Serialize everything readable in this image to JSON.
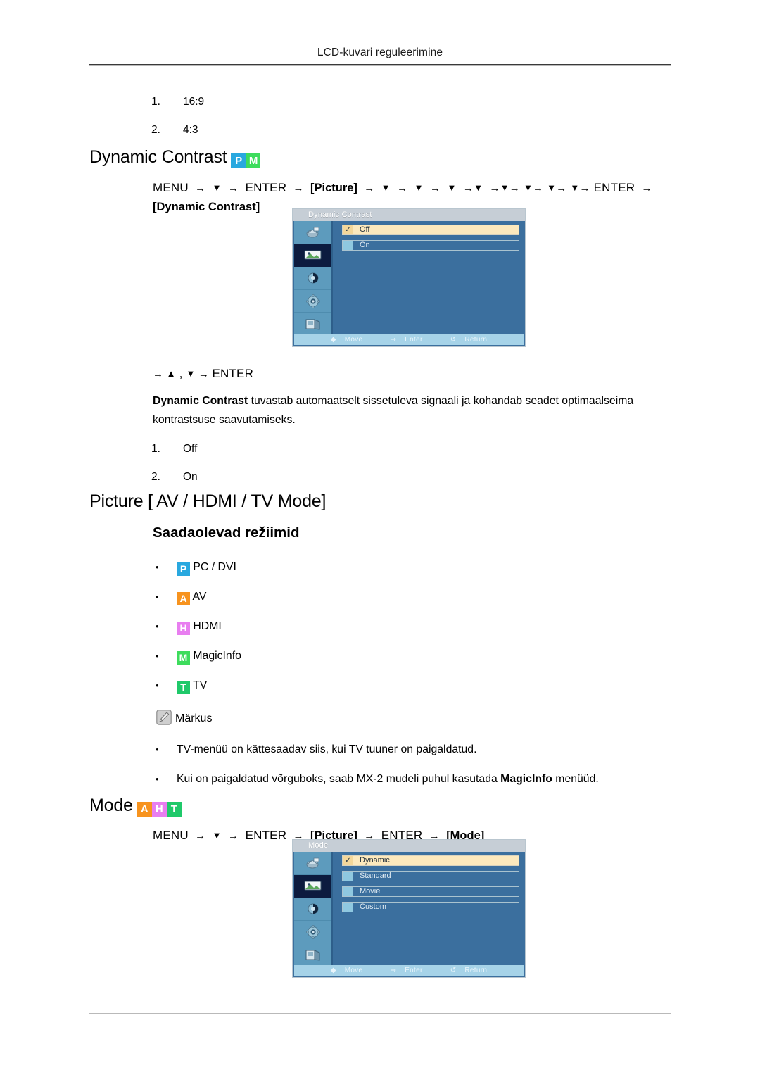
{
  "header": {
    "running_title": "LCD-kuvari reguleerimine"
  },
  "aspect_list": {
    "items": [
      {
        "n": "1.",
        "label": "16:9"
      },
      {
        "n": "2.",
        "label": "4:3"
      }
    ]
  },
  "dynamic_contrast": {
    "heading": "Dynamic Contrast",
    "badges": [
      {
        "letter": "P",
        "color": "#29a8df",
        "name": "badge-pc"
      },
      {
        "letter": "M",
        "color": "#3ddc5c",
        "name": "badge-magicinfo"
      }
    ],
    "path": {
      "menu": "MENU",
      "enter1": "ENTER",
      "picture_tag": "[Picture]",
      "enter2": "ENTER",
      "dc_tag": "[Dynamic Contrast]"
    },
    "nav_line": "→ ▲ , ▼ → ENTER",
    "description_bold": "Dynamic Contrast",
    "description_rest": " tuvastab automaatselt sissetuleva signaali ja kohandab seadet optimaalseima kontrastsuse saavutamiseks.",
    "options": [
      {
        "n": "1.",
        "label": "Off"
      },
      {
        "n": "2.",
        "label": "On"
      }
    ],
    "osd": {
      "title": "Dynamic Contrast",
      "items": [
        {
          "label": "Off",
          "selected": true
        },
        {
          "label": "On",
          "selected": false
        }
      ],
      "footer": [
        {
          "icon": "updown-icon",
          "glyph": "♦",
          "label": "Move"
        },
        {
          "icon": "enter-icon",
          "glyph": "↦",
          "label": "Enter"
        },
        {
          "icon": "return-icon",
          "glyph": "↺",
          "label": "Return"
        }
      ],
      "sidebar_icons": [
        {
          "name": "osd-icon-input",
          "active": false
        },
        {
          "name": "osd-icon-picture",
          "active": true
        },
        {
          "name": "osd-icon-sound",
          "active": false
        },
        {
          "name": "osd-icon-setup",
          "active": false
        },
        {
          "name": "osd-icon-multicontrol",
          "active": false
        }
      ]
    }
  },
  "picture_modes": {
    "heading": "Picture [ AV / HDMI / TV Mode]",
    "subheading": "Saadaolevad režiimid",
    "items": [
      {
        "letter": "P",
        "color": "#29a8df",
        "label": "PC / DVI",
        "name": "mode-pc-dvi"
      },
      {
        "letter": "A",
        "color": "#f7931e",
        "label": "AV",
        "name": "mode-av"
      },
      {
        "letter": "H",
        "color": "#e87ef0",
        "label": "HDMI",
        "name": "mode-hdmi"
      },
      {
        "letter": "M",
        "color": "#3ddc5c",
        "label": "MagicInfo",
        "name": "mode-magicinfo"
      },
      {
        "letter": "T",
        "color": "#1fc96a",
        "label": "TV",
        "name": "mode-tv"
      }
    ]
  },
  "note": {
    "label": "Märkus",
    "bullets": [
      {
        "text": "TV-menüü on kättesaadav siis, kui TV tuuner on paigaldatud."
      },
      {
        "pre": "Kui on paigaldatud võrguboks, saab MX-2 mudeli puhul kasutada ",
        "bold": "MagicInfo",
        "post": " menüüd."
      }
    ]
  },
  "mode": {
    "heading": "Mode",
    "badges": [
      {
        "letter": "A",
        "color": "#f7931e",
        "name": "badge-av"
      },
      {
        "letter": "H",
        "color": "#e87ef0",
        "name": "badge-hdmi"
      },
      {
        "letter": "T",
        "color": "#1fc96a",
        "name": "badge-tv"
      }
    ],
    "path": {
      "menu": "MENU",
      "enter1": "ENTER",
      "picture_tag": "[Picture]",
      "enter2": "ENTER",
      "mode_tag": "[Mode]"
    },
    "osd": {
      "title": "Mode",
      "items": [
        {
          "label": "Dynamic",
          "selected": true
        },
        {
          "label": "Standard",
          "selected": false
        },
        {
          "label": "Movie",
          "selected": false
        },
        {
          "label": "Custom",
          "selected": false
        }
      ],
      "footer": [
        {
          "icon": "updown-icon",
          "glyph": "♦",
          "label": "Move"
        },
        {
          "icon": "enter-icon",
          "glyph": "↦",
          "label": "Enter"
        },
        {
          "icon": "return-icon",
          "glyph": "↺",
          "label": "Return"
        }
      ],
      "sidebar_icons": [
        {
          "name": "osd-icon-input",
          "active": false
        },
        {
          "name": "osd-icon-picture",
          "active": true
        },
        {
          "name": "osd-icon-sound",
          "active": false
        },
        {
          "name": "osd-icon-setup",
          "active": false
        },
        {
          "name": "osd-icon-multicontrol",
          "active": false
        }
      ]
    }
  },
  "symbols": {
    "arrow": "→",
    "down": "▼",
    "up": "▲",
    "comma": ","
  }
}
